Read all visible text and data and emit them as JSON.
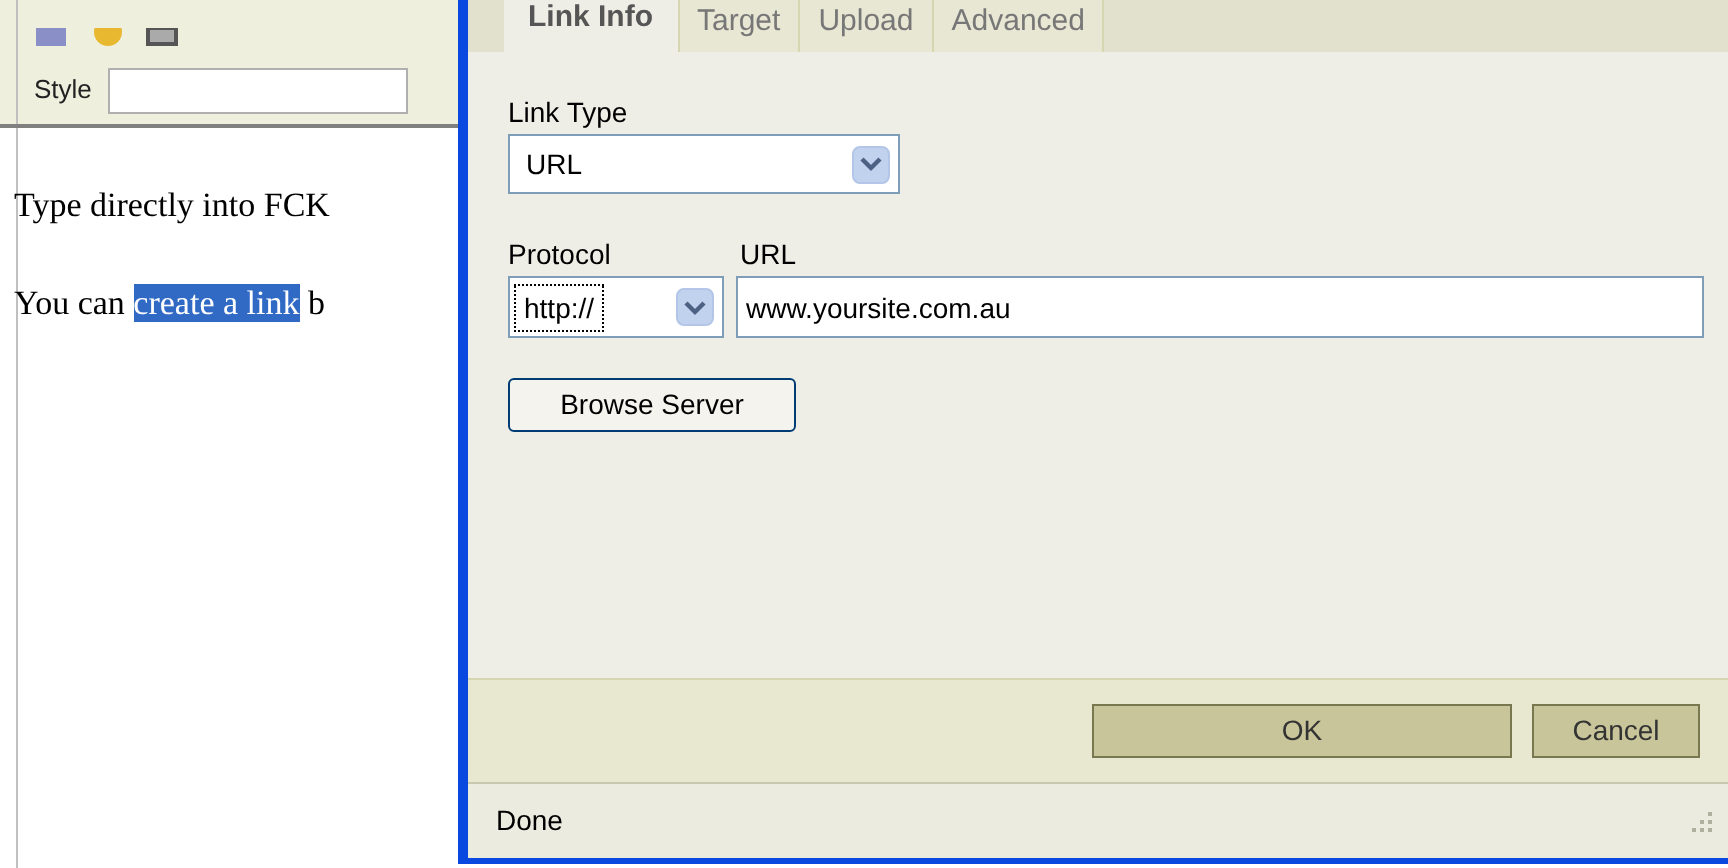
{
  "editor": {
    "style_label": "Style",
    "paragraphs": [
      {
        "parts": [
          {
            "text": "Type directly into FCK",
            "selected": false
          }
        ]
      },
      {
        "parts": [
          {
            "text": "You can ",
            "selected": false
          },
          {
            "text": "create a link",
            "selected": true
          },
          {
            "text": " b",
            "selected": false
          }
        ]
      }
    ]
  },
  "dialog": {
    "tabs": [
      {
        "label": "Link Info",
        "selected": true
      },
      {
        "label": "Target",
        "selected": false
      },
      {
        "label": "Upload",
        "selected": false
      },
      {
        "label": "Advanced",
        "selected": false
      }
    ],
    "link_type": {
      "label": "Link Type",
      "value": "URL"
    },
    "protocol": {
      "label": "Protocol",
      "value": "http://"
    },
    "url": {
      "label": "URL",
      "value": "www.yoursite.com.au"
    },
    "browse_button": "Browse Server",
    "buttons": [
      "OK",
      "Cancel"
    ],
    "status": "Done"
  }
}
